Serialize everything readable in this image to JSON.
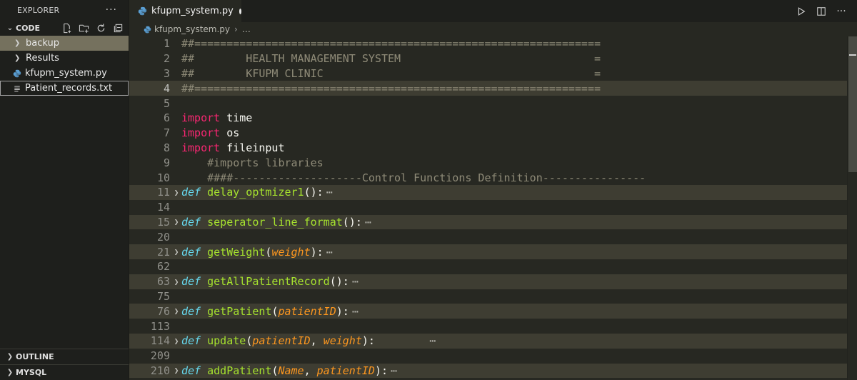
{
  "sidebar": {
    "title": "EXPLORER",
    "more": "···",
    "folder_name": "CODE",
    "items": [
      {
        "label": "backup",
        "type": "folder"
      },
      {
        "label": "Results",
        "type": "folder"
      },
      {
        "label": "kfupm_system.py",
        "type": "python-file"
      },
      {
        "label": "Patient_records.txt",
        "type": "text-file"
      }
    ],
    "bottom_sections": [
      "OUTLINE",
      "MYSQL"
    ]
  },
  "editor": {
    "tab_label": "kfupm_system.py",
    "breadcrumb": {
      "file": "kfupm_system.py",
      "rest": "…"
    },
    "lines": [
      {
        "n": "1",
        "tokens": [
          {
            "c": "comment",
            "t": "##==============================================================="
          }
        ]
      },
      {
        "n": "2",
        "tokens": [
          {
            "c": "comment",
            "t": "##        HEALTH MANAGEMENT SYSTEM                              ="
          }
        ]
      },
      {
        "n": "3",
        "tokens": [
          {
            "c": "comment",
            "t": "##        KFUPM CLINIC                                          ="
          }
        ]
      },
      {
        "n": "4",
        "current": true,
        "tokens": [
          {
            "c": "comment",
            "t": "##==============================================================="
          }
        ]
      },
      {
        "n": "5",
        "tokens": []
      },
      {
        "n": "6",
        "tokens": [
          {
            "c": "kw-import",
            "t": "import"
          },
          {
            "c": "",
            "t": " time"
          }
        ]
      },
      {
        "n": "7",
        "tokens": [
          {
            "c": "kw-import",
            "t": "import"
          },
          {
            "c": "",
            "t": " os"
          }
        ]
      },
      {
        "n": "8",
        "tokens": [
          {
            "c": "kw-import",
            "t": "import"
          },
          {
            "c": "",
            "t": " fileinput"
          }
        ]
      },
      {
        "n": "9",
        "tokens": [
          {
            "c": "comment",
            "t": "    #imports libraries"
          }
        ]
      },
      {
        "n": "10",
        "tokens": [
          {
            "c": "comment",
            "t": "    ####--------------------Control Functions Definition----------------"
          }
        ]
      },
      {
        "n": "11",
        "fold": true,
        "tokens": [
          {
            "c": "kw-def",
            "t": "def"
          },
          {
            "c": "",
            "t": " "
          },
          {
            "c": "fn",
            "t": "delay_optmizer1"
          },
          {
            "c": "",
            "t": "():"
          },
          {
            "c": "ellip",
            "t": "⋯"
          }
        ]
      },
      {
        "n": "14",
        "tokens": []
      },
      {
        "n": "15",
        "fold": true,
        "tokens": [
          {
            "c": "kw-def",
            "t": "def"
          },
          {
            "c": "",
            "t": " "
          },
          {
            "c": "fn",
            "t": "seperator_line_format"
          },
          {
            "c": "",
            "t": "():"
          },
          {
            "c": "ellip",
            "t": "⋯"
          }
        ]
      },
      {
        "n": "20",
        "tokens": []
      },
      {
        "n": "21",
        "fold": true,
        "tokens": [
          {
            "c": "kw-def",
            "t": "def"
          },
          {
            "c": "",
            "t": " "
          },
          {
            "c": "fn",
            "t": "getWeight"
          },
          {
            "c": "",
            "t": "("
          },
          {
            "c": "param",
            "t": "weight"
          },
          {
            "c": "",
            "t": "):"
          },
          {
            "c": "ellip",
            "t": "⋯"
          }
        ]
      },
      {
        "n": "62",
        "tokens": []
      },
      {
        "n": "63",
        "fold": true,
        "tokens": [
          {
            "c": "kw-def",
            "t": "def"
          },
          {
            "c": "",
            "t": " "
          },
          {
            "c": "fn",
            "t": "getAllPatientRecord"
          },
          {
            "c": "",
            "t": "():"
          },
          {
            "c": "ellip",
            "t": "⋯"
          }
        ]
      },
      {
        "n": "75",
        "tokens": []
      },
      {
        "n": "76",
        "fold": true,
        "tokens": [
          {
            "c": "kw-def",
            "t": "def"
          },
          {
            "c": "",
            "t": " "
          },
          {
            "c": "fn",
            "t": "getPatient"
          },
          {
            "c": "",
            "t": "("
          },
          {
            "c": "param",
            "t": "patientID"
          },
          {
            "c": "",
            "t": "):"
          },
          {
            "c": "ellip",
            "t": "⋯"
          }
        ]
      },
      {
        "n": "113",
        "tokens": []
      },
      {
        "n": "114",
        "fold": true,
        "tokens": [
          {
            "c": "kw-def",
            "t": "def"
          },
          {
            "c": "",
            "t": " "
          },
          {
            "c": "fn",
            "t": "update"
          },
          {
            "c": "",
            "t": "("
          },
          {
            "c": "param",
            "t": "patientID"
          },
          {
            "c": "",
            "t": ", "
          },
          {
            "c": "param",
            "t": "weight"
          },
          {
            "c": "",
            "t": "):        "
          },
          {
            "c": "ellip",
            "t": "⋯"
          }
        ]
      },
      {
        "n": "209",
        "tokens": []
      },
      {
        "n": "210",
        "fold": true,
        "tokens": [
          {
            "c": "kw-def",
            "t": "def"
          },
          {
            "c": "",
            "t": " "
          },
          {
            "c": "fn",
            "t": "addPatient"
          },
          {
            "c": "",
            "t": "("
          },
          {
            "c": "param",
            "t": "Name"
          },
          {
            "c": "",
            "t": ", "
          },
          {
            "c": "param",
            "t": "patientID"
          },
          {
            "c": "",
            "t": "):"
          },
          {
            "c": "ellip",
            "t": "⋯"
          }
        ]
      }
    ]
  },
  "colors": {
    "editor_bg": "#272822",
    "sidebar_bg": "#1e1f1c",
    "selection": "#75715e",
    "keyword_import": "#f92672",
    "keyword_def": "#66d9ef",
    "function": "#a6e22e",
    "parameter": "#fd971f",
    "comment": "#8f8b78"
  },
  "icons": [
    "new-file-icon",
    "new-folder-icon",
    "refresh-icon",
    "collapse-all-icon",
    "python-file-icon",
    "text-file-icon",
    "run-icon",
    "split-editor-icon",
    "more-actions-icon"
  ]
}
